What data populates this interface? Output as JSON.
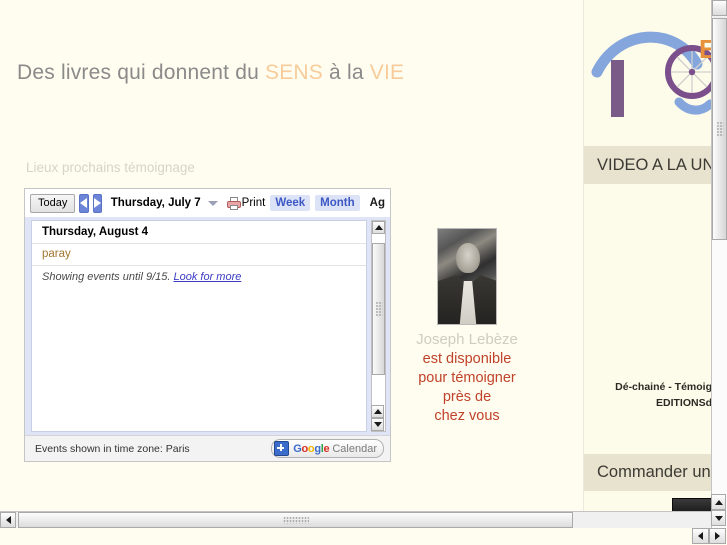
{
  "page": {
    "background_color": "#fffdf0",
    "accent_orange": "#e8913c",
    "accent_red": "#c0422a"
  },
  "tagline": {
    "part1": "Des livres qui donnent du ",
    "highlight1": "SENS",
    "part2": " à la ",
    "highlight2": "VIE"
  },
  "section": {
    "lieux_label": "Lieux prochains témoignage"
  },
  "calendar": {
    "toolbar": {
      "today_label": "Today",
      "prev_icon": "arrow-left-icon",
      "next_icon": "arrow-right-icon",
      "current_date": "Thursday, July 7",
      "date_caret_icon": "chevron-down-icon",
      "print_icon": "printer-icon",
      "print_label": "Print",
      "view_week": "Week",
      "view_month": "Month",
      "view_agenda": "Ag"
    },
    "agenda": {
      "day_header": "Thursday, August 4",
      "events": [
        {
          "title": "paray"
        }
      ],
      "more_text": "Showing events until 9/15. ",
      "more_link": "Look for more"
    },
    "footer": {
      "timezone_text": "Events shown in time zone: Paris",
      "badge_plus_icon": "plus-icon",
      "badge_brand_g": "G",
      "badge_brand_o1": "o",
      "badge_brand_o2": "o",
      "badge_brand_g2": "g",
      "badge_brand_l": "l",
      "badge_brand_e": "e",
      "badge_product": "Calendar"
    },
    "scrollbar": {
      "up_icon": "scroll-up-icon",
      "down_icon": "scroll-down-icon"
    }
  },
  "portrait": {
    "image_name": "joseph-lebeze-photo",
    "name": "Joseph Lebèze",
    "line1": "est disponible",
    "line2": "pour témoigner",
    "line3": "près de",
    "line4": "chez vous"
  },
  "sidebar": {
    "logo_name": "editions-logo",
    "logo_letter": "E",
    "band_video_title": "VIDEO A LA UN",
    "caption_line1": "Dé-chainé - Témoig",
    "caption_line2": "EDITIONSd",
    "band_commander_title": "Commander un",
    "product_image_name": "product-photo"
  },
  "browser": {
    "vscroll_up_icon": "scroll-up-icon",
    "vscroll_down_icon": "scroll-down-icon",
    "hscroll_left_icon": "scroll-left-icon",
    "hscroll_right_icon": "scroll-right-icon"
  }
}
